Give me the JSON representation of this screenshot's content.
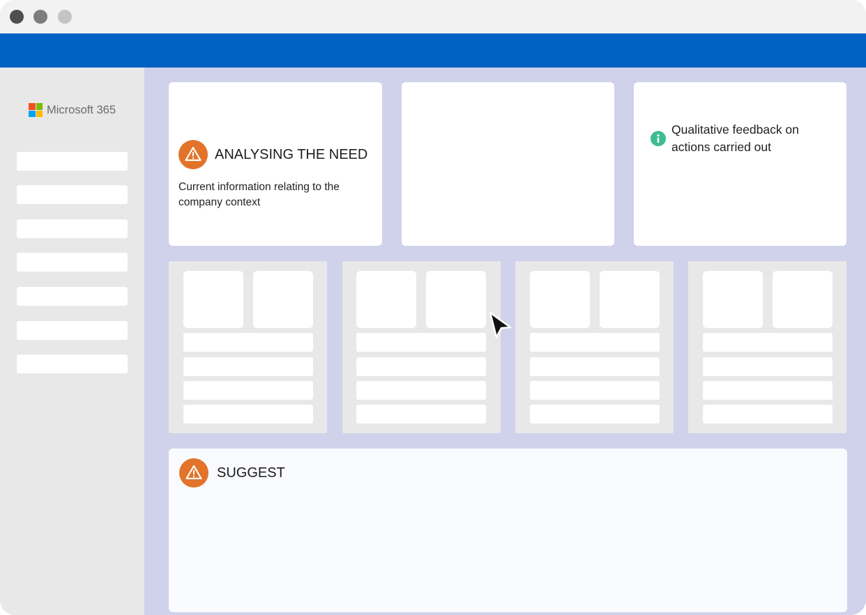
{
  "window": {
    "controls": [
      "close",
      "minimize",
      "maximize"
    ]
  },
  "sidebar": {
    "brand": {
      "name": "Microsoft 365",
      "logo_colors": [
        "#f25022",
        "#7fba00",
        "#00a4ef",
        "#ffb900"
      ]
    },
    "items_count": 7
  },
  "cards": {
    "analysing": {
      "title": "ANALYSING THE NEED",
      "text": "Current information relating to the company context",
      "icon": "warning-icon"
    },
    "feedback": {
      "text": "Qualitative feedback on actions carried out",
      "icon": "info-icon"
    }
  },
  "suggest": {
    "title": "SUGGEST",
    "icon": "warning-icon"
  },
  "colors": {
    "app_bar": "#0063c3",
    "content_bg": "#d0d1eb",
    "warning": "#e2732a",
    "info": "#3ebc93"
  }
}
